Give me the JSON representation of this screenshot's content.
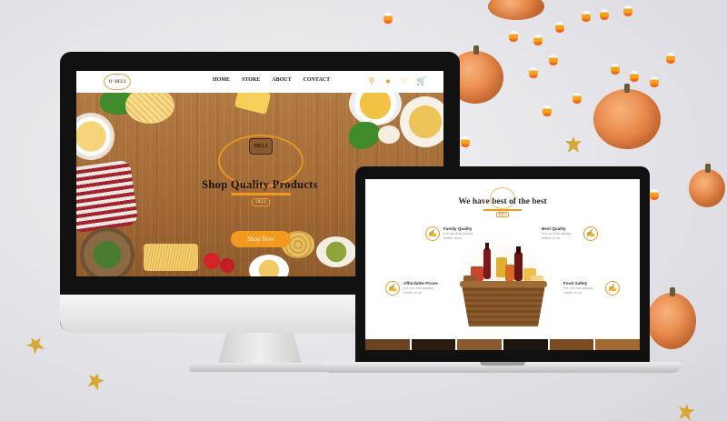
{
  "brand": {
    "logo_text": "O' DELI",
    "accent_color": "#f29a1f",
    "dark_wood_color": "#a46c37"
  },
  "desktop_site": {
    "nav": {
      "links": [
        "HOME",
        "STORE",
        "ABOUT",
        "CONTACT"
      ],
      "icons": [
        "search-icon",
        "user-icon",
        "heart-icon",
        "cart-icon"
      ]
    },
    "hero": {
      "title": "Shop Quality Products",
      "emblem_text": "DELI",
      "tag_text": "DELI",
      "cta_label": "Shop Now"
    }
  },
  "laptop_site": {
    "section_title": "We have best of the best",
    "emblem_tag": "DELI",
    "features": [
      {
        "title": "Family Quality",
        "desc": "It is our that always matter to us",
        "icon": "hand-icon"
      },
      {
        "title": "Best Quality",
        "desc": "It is our that always matter to us",
        "icon": "hand-icon"
      },
      {
        "title": "Affordable Prices",
        "desc": "It is our that always matter to us",
        "icon": "hand-icon"
      },
      {
        "title": "Food Safety",
        "desc": "It is our that always matter to us",
        "icon": "hand-icon"
      }
    ]
  }
}
